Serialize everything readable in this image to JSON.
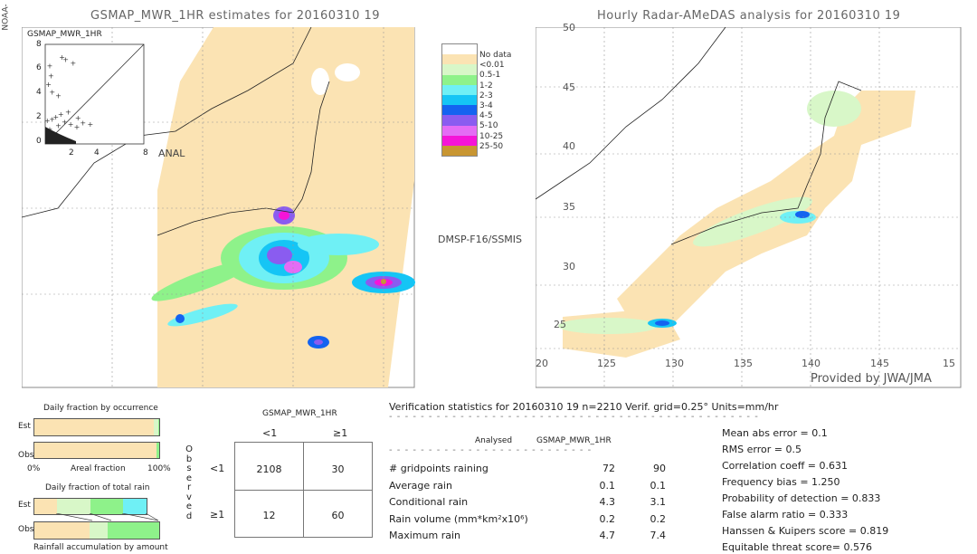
{
  "side_label": "NOAA-",
  "left_map": {
    "title": "GSMAP_MWR_1HR estimates for 20160310 19",
    "inset_label": "GSMAP_MWR_1HR",
    "inset_ticks": [
      "0",
      "2",
      "4",
      "6",
      "8"
    ],
    "inset_xlabel": "ANAL",
    "sensor_label": "DMSP-F16/SSMIS"
  },
  "right_map": {
    "title": "Hourly Radar-AMeDAS analysis for 20160310 19",
    "lat_ticks": [
      "50",
      "45",
      "40",
      "35",
      "30",
      "25",
      "20"
    ],
    "lon_ticks": [
      "125",
      "130",
      "135",
      "140",
      "145",
      "15"
    ],
    "credit": "Provided by JWA/JMA"
  },
  "legend": {
    "items": [
      {
        "label": "No data",
        "color": "#ffffff"
      },
      {
        "label": "<0.01",
        "color": "#fbe3b3"
      },
      {
        "label": "0.5-1",
        "color": "#d8f7c8"
      },
      {
        "label": "1-2",
        "color": "#8ef28a"
      },
      {
        "label": "2-3",
        "color": "#6ff0f5"
      },
      {
        "label": "3-4",
        "color": "#15c5f5"
      },
      {
        "label": "4-5",
        "color": "#1463f0"
      },
      {
        "label": "5-10",
        "color": "#8a5cf0"
      },
      {
        "label": "10-25",
        "color": "#e46cf5"
      },
      {
        "label": "25-50",
        "color": "#f514d8"
      },
      {
        "label": "",
        "color": "#c89632"
      }
    ]
  },
  "occurrence": {
    "title": "Daily fraction by occurrence",
    "est_label": "Est",
    "obs_label": "Obs",
    "axis_left": "0%",
    "axis_mid": "Areal fraction",
    "axis_right": "100%"
  },
  "total_rain": {
    "title": "Daily fraction of total rain",
    "est_label": "Est",
    "obs_label": "Obs",
    "footer": "Rainfall accumulation by amount"
  },
  "contingency": {
    "header": "GSMAP_MWR_1HR",
    "col_labels": [
      "<1",
      "≥1"
    ],
    "row_labels": [
      "<1",
      "≥1"
    ],
    "side_label": [
      "O",
      "b",
      "s",
      "e",
      "r",
      "v",
      "e",
      "d"
    ],
    "cells": [
      [
        "2108",
        "30"
      ],
      [
        "12",
        "60"
      ]
    ]
  },
  "stats": {
    "header": "Verification statistics for 20160310 19   n=2210   Verif. grid=0.25°   Units=mm/hr",
    "divider": "- - - - - - - - - - - - - - - - - - - - - - - - - - - - - - - - - - - - - - - - - - - - - - -",
    "col_analysed": "Analysed",
    "col_estimate": "GSMAP_MWR_1HR",
    "sub_divider": "- - - - - - - - - - - - - - - - - - - - - - - - - -",
    "rows": [
      {
        "label": "# gridpoints raining",
        "analysed": "72",
        "estimate": "90"
      },
      {
        "label": "Average rain",
        "analysed": "0.1",
        "estimate": "0.1"
      },
      {
        "label": "Conditional rain",
        "analysed": "4.3",
        "estimate": "3.1"
      },
      {
        "label": "Rain volume (mm*km²x10⁶)",
        "analysed": "0.2",
        "estimate": "0.2"
      },
      {
        "label": "Maximum rain",
        "analysed": "4.7",
        "estimate": "7.4"
      }
    ],
    "scores": [
      "Mean abs error = 0.1",
      "RMS error = 0.5",
      "Correlation coeff = 0.631",
      "Frequency bias = 1.250",
      "Probability of detection = 0.833",
      "False alarm ratio = 0.333",
      "Hanssen & Kuipers score = 0.819",
      "Equitable threat score= 0.576"
    ]
  },
  "chart_data": [
    {
      "type": "scatter",
      "title": "GSMAP_MWR_1HR",
      "xlabel": "ANAL",
      "ylabel": "GSMAP_MWR_1HR",
      "xlim": [
        0,
        8
      ],
      "ylim": [
        0,
        8
      ],
      "points": [
        [
          0.1,
          0.3
        ],
        [
          0.2,
          0.8
        ],
        [
          0.3,
          1.2
        ],
        [
          0.5,
          2.0
        ],
        [
          0.8,
          2.2
        ],
        [
          1.0,
          1.5
        ],
        [
          1.2,
          2.4
        ],
        [
          1.5,
          1.8
        ],
        [
          2.0,
          1.6
        ],
        [
          2.5,
          1.4
        ],
        [
          3.0,
          1.7
        ],
        [
          0.2,
          4.8
        ],
        [
          0.5,
          4.2
        ],
        [
          0.4,
          5.5
        ],
        [
          1.6,
          6.8
        ],
        [
          1.3,
          7.0
        ],
        [
          2.2,
          6.5
        ],
        [
          0.3,
          6.3
        ],
        [
          1.0,
          3.9
        ],
        [
          2.6,
          2.1
        ],
        [
          0.6,
          0.5
        ],
        [
          0.1,
          1.9
        ],
        [
          1.8,
          2.6
        ],
        [
          3.6,
          1.6
        ]
      ]
    },
    {
      "type": "bar",
      "title": "Daily fraction by occurrence",
      "categories": [
        "Est",
        "Obs"
      ],
      "series": [
        {
          "values": [
            96,
            98
          ]
        },
        {
          "values": [
            4,
            2
          ]
        }
      ]
    },
    {
      "type": "bar",
      "title": "Daily fraction of total rain",
      "categories": [
        "Est",
        "Obs"
      ],
      "series": [
        {
          "values": [
            18,
            44
          ]
        },
        {
          "values": [
            27,
            15
          ]
        },
        {
          "values": [
            26,
            41
          ]
        },
        {
          "values": [
            19,
            0
          ]
        }
      ]
    }
  ]
}
